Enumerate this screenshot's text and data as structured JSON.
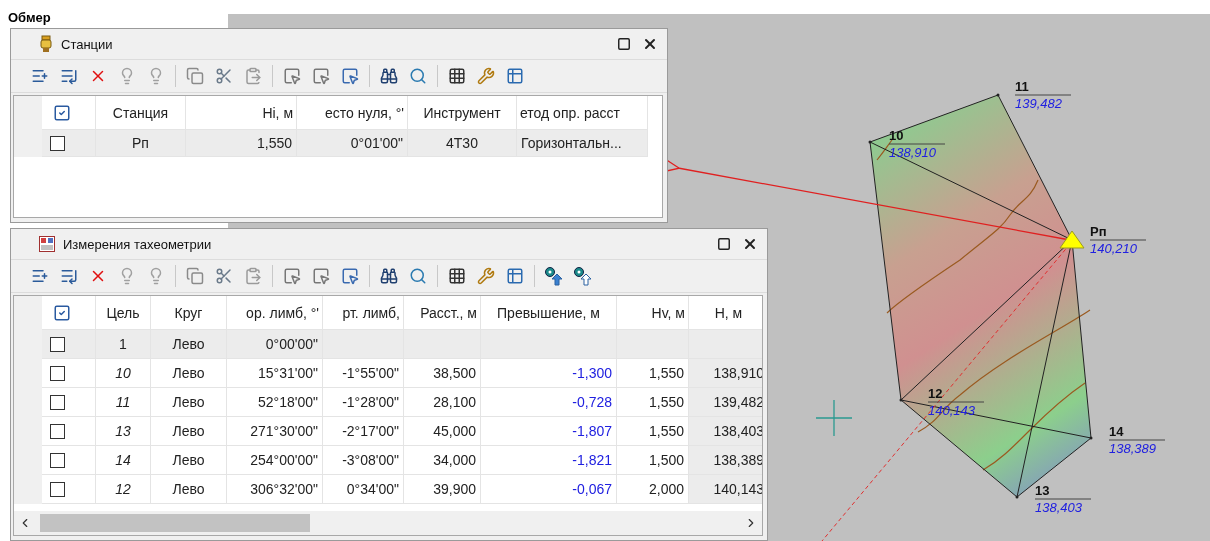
{
  "page_title": "Обмер",
  "stations": {
    "title": "Станции",
    "columns": [
      {
        "label": "Станция",
        "kind": "text"
      },
      {
        "label": "Hi, м",
        "kind": "number"
      },
      {
        "label": "есто нуля, °'",
        "kind": "number"
      },
      {
        "label": "Инструмент",
        "kind": "text"
      },
      {
        "label": "етод опр. расст",
        "kind": "left"
      }
    ],
    "rows": [
      {
        "checked": false,
        "selected": true,
        "cells": [
          "Рп",
          "1,550",
          "0°01'00\"",
          "4Т30",
          "Горизонтальн..."
        ]
      }
    ]
  },
  "measurements": {
    "title": "Измерения тахеометрии",
    "columns": [
      {
        "label": "Цель",
        "kind": "text"
      },
      {
        "label": "Круг",
        "kind": "text"
      },
      {
        "label": "ор. лимб, °'",
        "kind": "number"
      },
      {
        "label": "рт. лимб,",
        "kind": "number"
      },
      {
        "label": "Расст., м",
        "kind": "number"
      },
      {
        "label": "Превышение, м",
        "kind": "delta"
      },
      {
        "label": "Hv, м",
        "kind": "number"
      },
      {
        "label": "H, м",
        "kind": "computed"
      }
    ],
    "rows": [
      {
        "checked": false,
        "kind": "orientation",
        "cells": [
          "1",
          "Лево",
          "0°00'00\"",
          "",
          "",
          "",
          "",
          ""
        ]
      },
      {
        "checked": false,
        "kind": "target",
        "cells": [
          "10",
          "Лево",
          "15°31'00\"",
          "-1°55'00\"",
          "38,500",
          "-1,300",
          "1,550",
          "138,910"
        ]
      },
      {
        "checked": false,
        "kind": "target",
        "cells": [
          "11",
          "Лево",
          "52°18'00\"",
          "-1°28'00\"",
          "28,100",
          "-0,728",
          "1,550",
          "139,482"
        ]
      },
      {
        "checked": false,
        "kind": "target",
        "cells": [
          "13",
          "Лево",
          "271°30'00\"",
          "-2°17'00\"",
          "45,000",
          "-1,807",
          "1,550",
          "138,403"
        ]
      },
      {
        "checked": false,
        "kind": "target",
        "cells": [
          "14",
          "Лево",
          "254°00'00\"",
          "-3°08'00\"",
          "34,000",
          "-1,821",
          "1,500",
          "138,389"
        ]
      },
      {
        "checked": false,
        "kind": "target",
        "cells": [
          "12",
          "Лево",
          "306°32'00\"",
          "0°34'00\"",
          "39,900",
          "-0,067",
          "2,000",
          "140,143"
        ]
      }
    ]
  },
  "map": {
    "points": [
      {
        "name": "10",
        "elevation": "138,910",
        "kind": "point"
      },
      {
        "name": "11",
        "elevation": "139,482",
        "kind": "point"
      },
      {
        "name": "Рп",
        "elevation": "140,210",
        "kind": "station"
      },
      {
        "name": "12",
        "elevation": "140,143",
        "kind": "point"
      },
      {
        "name": "14",
        "elevation": "138,389",
        "kind": "point"
      },
      {
        "name": "13",
        "elevation": "138,403",
        "kind": "point"
      }
    ]
  }
}
